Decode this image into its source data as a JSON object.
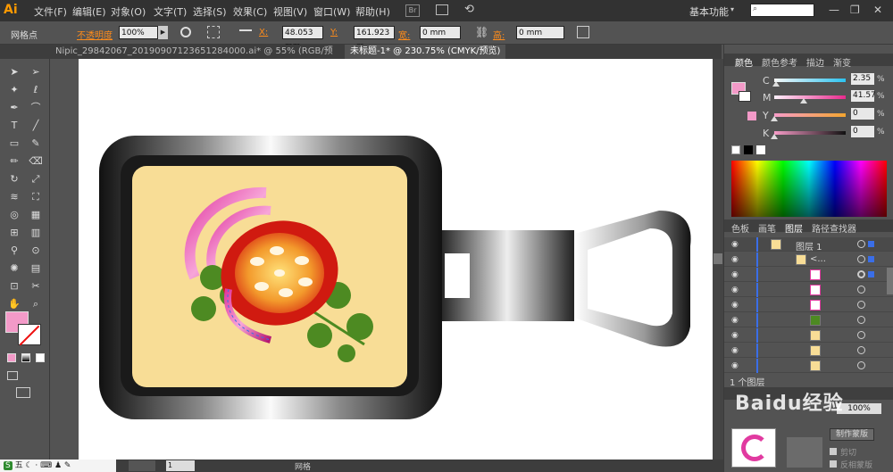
{
  "menu": {
    "logo": "Ai",
    "items": [
      "文件(F)",
      "编辑(E)",
      "对象(O)",
      "文字(T)",
      "选择(S)",
      "效果(C)",
      "视图(V)",
      "窗口(W)",
      "帮助(H)"
    ],
    "workspace": "基本功能",
    "br_label": "Br"
  },
  "control": {
    "selection": "网格点",
    "opacity_label": "不透明度",
    "opacity_value": "100%",
    "x_label": "X:",
    "x_value": "48.053 mm",
    "y_label": "Y:",
    "y_value": "161.923 m",
    "w_label": "宽:",
    "w_value": "0 mm",
    "h_label": "高:",
    "h_value": "0 mm"
  },
  "tabs": [
    {
      "label": "Nipic_29842067_20190907123651284000.ai* @ 55% (RGB/预览)",
      "active": false
    },
    {
      "label": "未标题-1* @ 230.75% (CMYK/预览)",
      "active": true
    }
  ],
  "color_panel": {
    "tabs": [
      "颜色",
      "颜色参考",
      "描边",
      "渐变"
    ],
    "channels": [
      {
        "label": "C",
        "value": "2.35",
        "pct": 0.0235,
        "gradient": "linear-gradient(to right,#f7f7f7,#2cc3f0)"
      },
      {
        "label": "M",
        "value": "41.57",
        "pct": 0.4157,
        "gradient": "linear-gradient(to right,#fff0fa,#e82a8d)"
      },
      {
        "label": "Y",
        "value": "0",
        "pct": 0,
        "gradient": "linear-gradient(to right,#f79cc8,#f3a52f)"
      },
      {
        "label": "K",
        "value": "0",
        "pct": 0,
        "gradient": "linear-gradient(to right,#f79cc8,#111)"
      }
    ],
    "unit": "%",
    "fill_color": "#f39ac8"
  },
  "layers_panel": {
    "tabs": [
      "色板",
      "画笔",
      "图层",
      "路径查找器"
    ],
    "layer_name": "图层 1",
    "group_name": "<...",
    "count_label": "1 个图层",
    "rows": [
      {
        "kind": "layer"
      },
      {
        "kind": "group"
      },
      {
        "kind": "item",
        "thumb": "magenta-ring"
      },
      {
        "kind": "item",
        "thumb": "magenta-ring"
      },
      {
        "kind": "item",
        "thumb": "magenta-ring"
      },
      {
        "kind": "item",
        "thumb": "leaf"
      },
      {
        "kind": "item",
        "thumb": "plain"
      },
      {
        "kind": "item",
        "thumb": "plain"
      },
      {
        "kind": "item",
        "thumb": "plain"
      }
    ]
  },
  "transparency_panel": {
    "mask_btn": "制作蒙版",
    "clip_label": "剪切",
    "invert_label": "反相蒙版",
    "opacity": "100%"
  },
  "status": {
    "zoom": "230.75%",
    "page": "1",
    "status_text": "网格"
  },
  "taskbar": {
    "ime": "五",
    "items": [
      "S",
      "五"
    ]
  },
  "watermark": "Baidu经验",
  "colors": {
    "accent_orange": "#ff8c1a",
    "selection_blue": "#3a6ee8",
    "pan_bg": "#f8dd96"
  }
}
